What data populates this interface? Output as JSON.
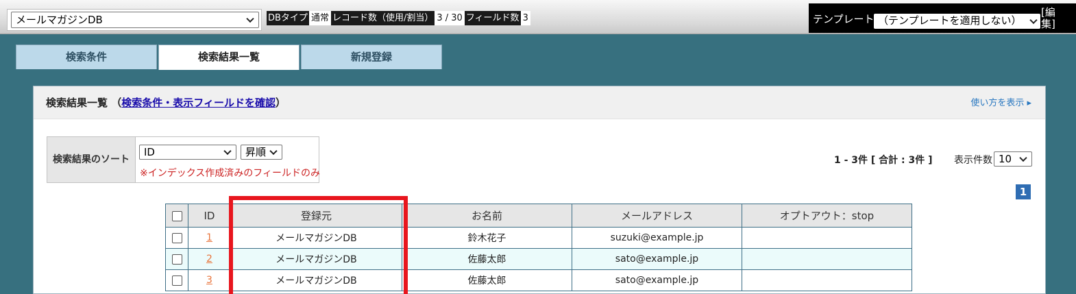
{
  "topbar": {
    "db_select_value": "メールマガジンDB",
    "db_type_label": "DBタイプ",
    "db_type_value": "通常",
    "record_count_label": "レコード数（使用/割当）",
    "record_count_value": "3 / 30",
    "field_count_label": "フィールド数",
    "field_count_value": "3",
    "template_label": "テンプレート",
    "template_select_value": "（テンプレートを適用しない）",
    "template_edit_label": "[編集]"
  },
  "tabs": [
    {
      "label": "検索条件"
    },
    {
      "label": "検索結果一覧",
      "active": true
    },
    {
      "label": "新規登録"
    }
  ],
  "panel": {
    "title": "検索結果一覧",
    "title_open": "（",
    "title_link": "検索条件・表示フィールドを確認",
    "title_close": "）",
    "howto": "使い方を表示 ▸"
  },
  "sort": {
    "label": "検索結果のソート",
    "field_value": "ID",
    "order_value": "昇順",
    "note": "※インデックス作成済みのフィールドのみ"
  },
  "paging": {
    "count_text": "1 - 3件 [ 合計 : 3件 ]",
    "per_page_label": "表示件数",
    "per_page_value": "10",
    "current_page": "1"
  },
  "table": {
    "headers": [
      "ID",
      "登録元",
      "お名前",
      "メールアドレス",
      "オプトアウト：stop"
    ],
    "rows": [
      {
        "id": "1",
        "source": "メールマガジンDB",
        "name": "鈴木花子",
        "email": "suzuki@example.jp",
        "optout": ""
      },
      {
        "id": "2",
        "source": "メールマガジンDB",
        "name": "佐藤太郎",
        "email": "sato@example.jp",
        "optout": ""
      },
      {
        "id": "3",
        "source": "メールマガジンDB",
        "name": "佐藤太郎",
        "email": "sato@example.jp",
        "optout": ""
      }
    ]
  },
  "colors": {
    "background": "#37707f",
    "tab_inactive": "#bcd9ea",
    "row_alt": "#ebfbfb",
    "link_id": "#e8743b",
    "highlight": "#e8161e",
    "page_badge": "#2f6db3"
  }
}
